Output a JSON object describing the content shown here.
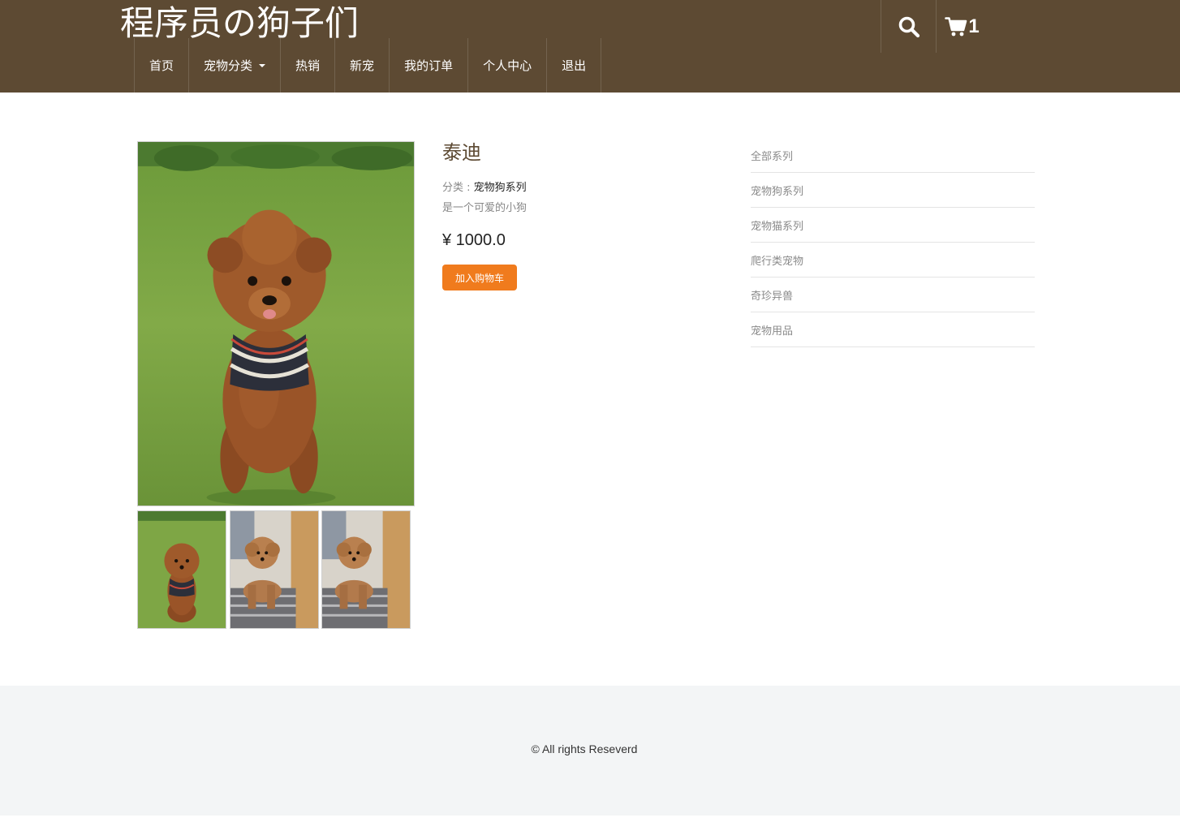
{
  "header": {
    "site_title": "程序员の狗子们",
    "cart_count": "1",
    "icons": {
      "search": "search-icon",
      "cart": "cart-icon",
      "dropdown": "caret-down-icon"
    },
    "colors": {
      "header_bg": "#5d4a33",
      "accent": "#f07b1d"
    }
  },
  "nav": {
    "items": [
      {
        "label": "首页"
      },
      {
        "label": "宠物分类"
      },
      {
        "label": "热销"
      },
      {
        "label": "新宠"
      },
      {
        "label": "我的订单"
      },
      {
        "label": "个人中心"
      },
      {
        "label": "退出"
      }
    ]
  },
  "product": {
    "name": "泰迪",
    "category_label": "分类 : ",
    "category_value": "宠物狗系列",
    "description": "是一个可爱的小狗",
    "price": "¥ 1000.0",
    "add_to_cart": "加入购物车"
  },
  "categories": [
    {
      "label": "全部系列"
    },
    {
      "label": "宠物狗系列"
    },
    {
      "label": "宠物猫系列"
    },
    {
      "label": "爬行类宠物"
    },
    {
      "label": "奇珍异兽"
    },
    {
      "label": "宠物用品"
    }
  ],
  "footer": {
    "text": "© All rights Reseverd"
  }
}
